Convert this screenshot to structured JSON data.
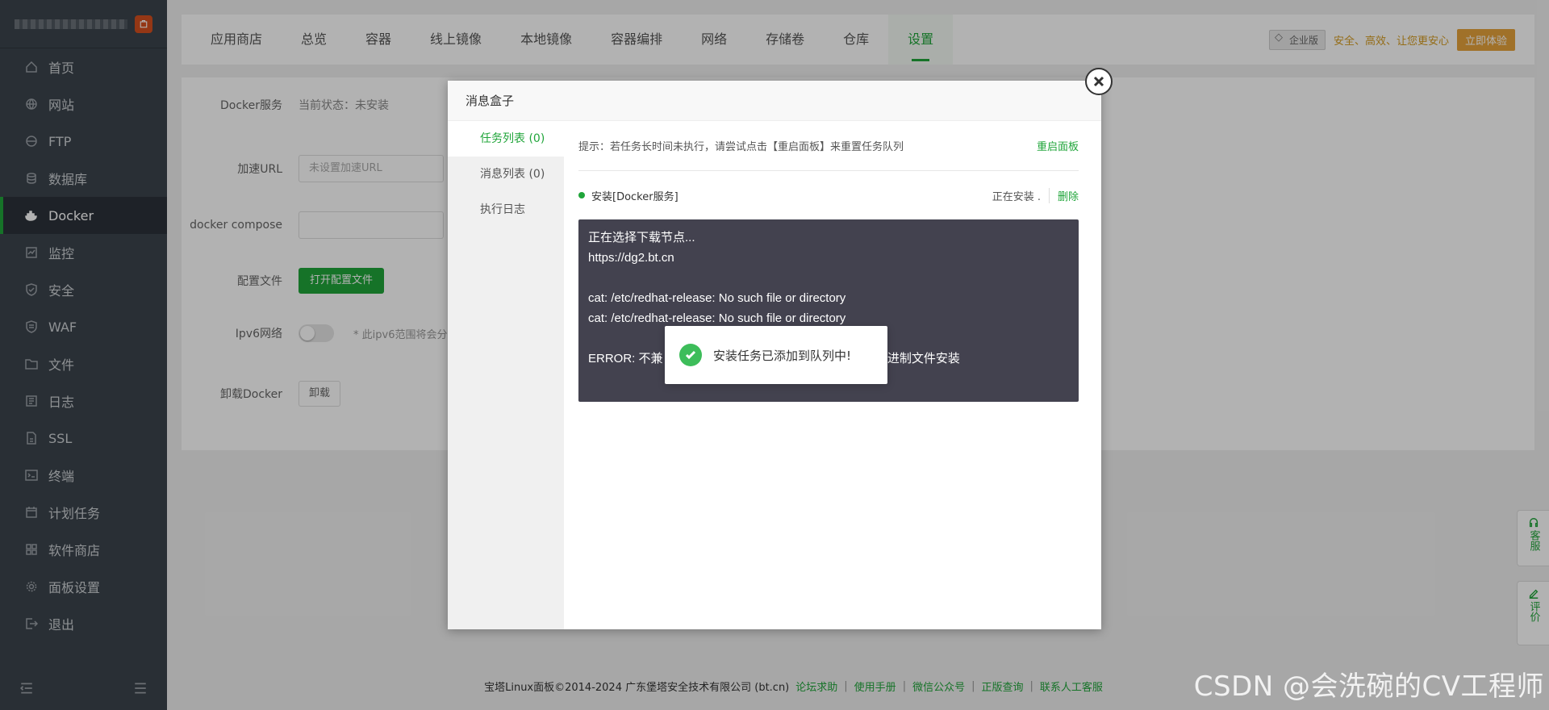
{
  "sidebar": {
    "items": [
      {
        "label": "首页",
        "icon": "home-icon"
      },
      {
        "label": "网站",
        "icon": "globe-icon"
      },
      {
        "label": "FTP",
        "icon": "ftp-icon"
      },
      {
        "label": "数据库",
        "icon": "database-icon"
      },
      {
        "label": "Docker",
        "icon": "docker-icon",
        "active": true
      },
      {
        "label": "监控",
        "icon": "monitor-icon"
      },
      {
        "label": "安全",
        "icon": "shield-icon"
      },
      {
        "label": "WAF",
        "icon": "waf-shield-icon"
      },
      {
        "label": "文件",
        "icon": "folder-icon"
      },
      {
        "label": "日志",
        "icon": "log-icon"
      },
      {
        "label": "SSL",
        "icon": "ssl-icon"
      },
      {
        "label": "终端",
        "icon": "terminal-icon"
      },
      {
        "label": "计划任务",
        "icon": "calendar-icon"
      },
      {
        "label": "软件商店",
        "icon": "grid-icon"
      },
      {
        "label": "面板设置",
        "icon": "gear-icon"
      },
      {
        "label": "退出",
        "icon": "logout-icon"
      }
    ]
  },
  "topnav": {
    "tabs": [
      "应用商店",
      "总览",
      "容器",
      "线上镜像",
      "本地镜像",
      "容器编排",
      "网络",
      "存储卷",
      "仓库",
      "设置"
    ],
    "active_tab": "设置",
    "enterprise_badge": "企业版",
    "enterprise_slogan": "安全、高效、让您更安心",
    "enterprise_button": "立即体验"
  },
  "settings": {
    "docker_service_label": "Docker服务",
    "docker_service_value": "当前状态：未安装",
    "accel_url_label": "加速URL",
    "accel_url_placeholder": "未设置加速URL",
    "compose_label": "docker compose",
    "config_label": "配置文件",
    "config_button": "打开配置文件",
    "ipv6_label": "Ipv6网络",
    "ipv6_hint": "* 此ipv6范围将会分配给容器",
    "uninstall_label": "卸载Docker",
    "uninstall_button": "卸载"
  },
  "modal": {
    "title": "消息盒子",
    "tabs": [
      "任务列表 (0)",
      "消息列表 (0)",
      "执行日志"
    ],
    "tip": "提示：若任务长时间未执行，请尝试点击【重启面板】来重置任务队列",
    "restart_link": "重启面板",
    "task_name": "安装[Docker服务]",
    "task_status": "正在安装 .",
    "task_delete": "删除",
    "log_lines": [
      "正在选择下载节点...",
      "https://dg2.bt.cn",
      "",
      "cat: /etc/redhat-release: No such file or directory",
      "cat: /etc/redhat-release: No such file or directory",
      "",
      "ERROR: 不兼                                                        使用二进制文件安装"
    ]
  },
  "toast": {
    "message": "安装任务已添加到队列中!"
  },
  "footer": {
    "copyright": "宝塔Linux面板©2014-2024 广东堡塔安全技术有限公司 (bt.cn)",
    "links": [
      "论坛求助",
      "使用手册",
      "微信公众号",
      "正版查询",
      "联系人工客服"
    ]
  },
  "float_buttons": {
    "service": "客服",
    "review": "评价"
  },
  "watermark": "CSDN @会洗碗的CV工程师",
  "colors": {
    "accent": "#20a53a",
    "sidebar_bg": "#3c444d",
    "log_bg": "#43424f",
    "enterprise": "#e6a23c"
  }
}
